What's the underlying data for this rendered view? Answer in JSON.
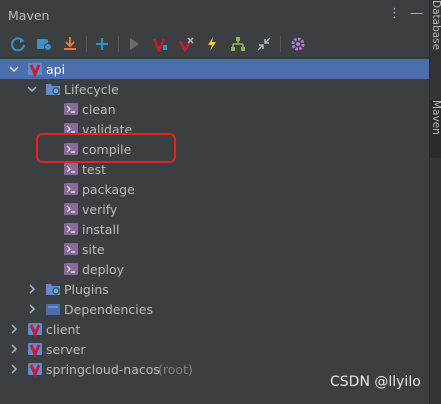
{
  "window": {
    "title": "Maven"
  },
  "title_actions": {
    "more": "⋮",
    "minimize": "—"
  },
  "toolbar": {
    "icons": [
      "refresh-icon",
      "reimport-icon",
      "download-icon",
      "add-icon",
      "run-icon",
      "execute-goal-icon",
      "toggle-offline-icon",
      "skip-tests-icon",
      "show-dependencies-icon",
      "collapse-all-icon",
      "settings-icon"
    ]
  },
  "tree": {
    "root": {
      "label": "api"
    },
    "lifecycle": {
      "label": "Lifecycle",
      "goals": [
        "clean",
        "validate",
        "compile",
        "test",
        "package",
        "verify",
        "install",
        "site",
        "deploy"
      ]
    },
    "plugins": {
      "label": "Plugins"
    },
    "dependencies": {
      "label": "Dependencies"
    },
    "modules": [
      {
        "label": "client"
      },
      {
        "label": "server"
      },
      {
        "label": "springcloud-nacos",
        "note": "(root)"
      }
    ]
  },
  "sidebar": {
    "tabs": [
      "Database",
      "Maven"
    ]
  },
  "watermark": "CSDN @llyilo",
  "colors": {
    "background": "#3c3f41",
    "selection": "#4b6eaf",
    "maven_icon": "#c71a36",
    "folder": "#5e8ccf",
    "highlight_box": "#e0241f"
  }
}
